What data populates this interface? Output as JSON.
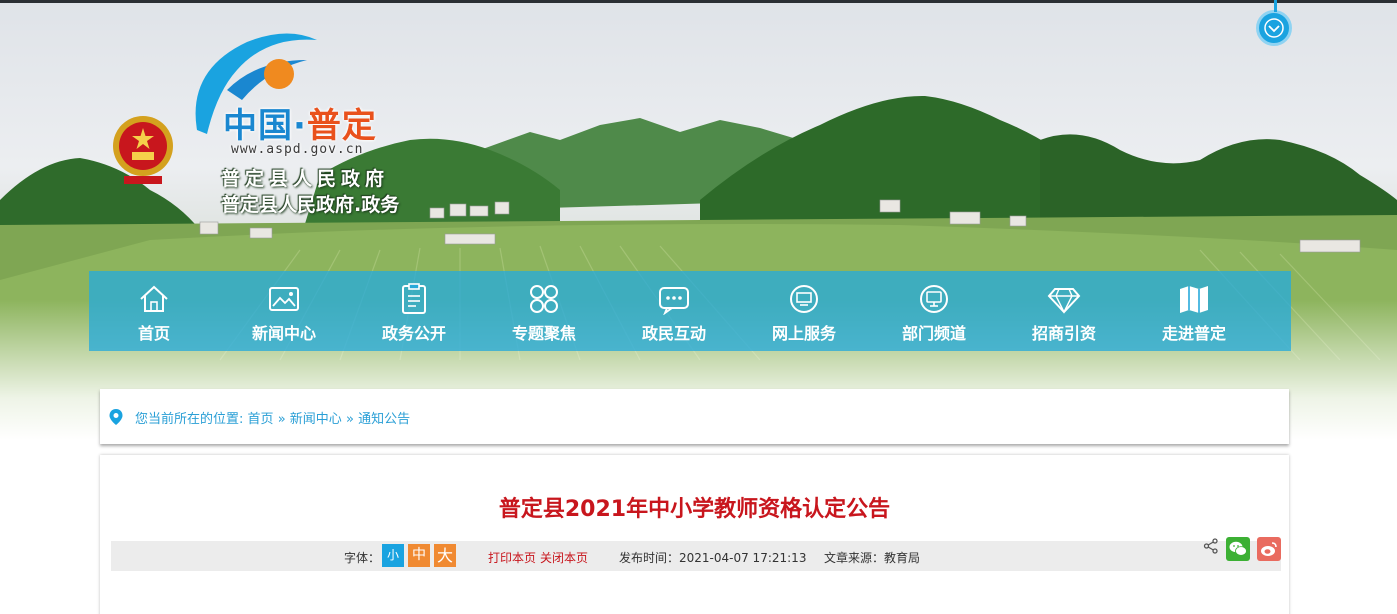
{
  "brand": {
    "logo_cn_part1": "中国",
    "logo_dot": "·",
    "logo_cn_part2": "普定",
    "url": "www.aspd.gov.cn",
    "name": "普定县人民政府",
    "subname": "普定县人民政府.政务",
    "accent_orange": "#e9511c",
    "accent_blue": "#1a87d0"
  },
  "nav": {
    "items": [
      {
        "label": "首页",
        "icon": "home-icon"
      },
      {
        "label": "新闻中心",
        "icon": "image-icon"
      },
      {
        "label": "政务公开",
        "icon": "document-icon"
      },
      {
        "label": "专题聚焦",
        "icon": "grid-circles-icon"
      },
      {
        "label": "政民互动",
        "icon": "chat-icon"
      },
      {
        "label": "网上服务",
        "icon": "monitor-icon"
      },
      {
        "label": "部门频道",
        "icon": "screen-icon"
      },
      {
        "label": "招商引资",
        "icon": "diamond-icon"
      },
      {
        "label": "走进普定",
        "icon": "map-icon"
      }
    ],
    "bg_color": "#28aada"
  },
  "breadcrumb": {
    "prefix": "您当前所在的位置:",
    "items": [
      "首页",
      "新闻中心",
      "通知公告"
    ],
    "separator": "»"
  },
  "article": {
    "title": "普定县2021年中小学教师资格认定公告",
    "font_label": "字体：",
    "font_small": "小",
    "font_medium": "中",
    "font_large": "大",
    "print": "打印本页",
    "close": "关闭本页",
    "publish_time": "发布时间：2021-04-07 17:21:13",
    "source": "文章来源：教育局",
    "title_color": "#c8161d"
  },
  "share": {
    "share_icon": "share-icon",
    "wechat_icon": "wechat-icon",
    "weibo_icon": "weibo-icon"
  }
}
